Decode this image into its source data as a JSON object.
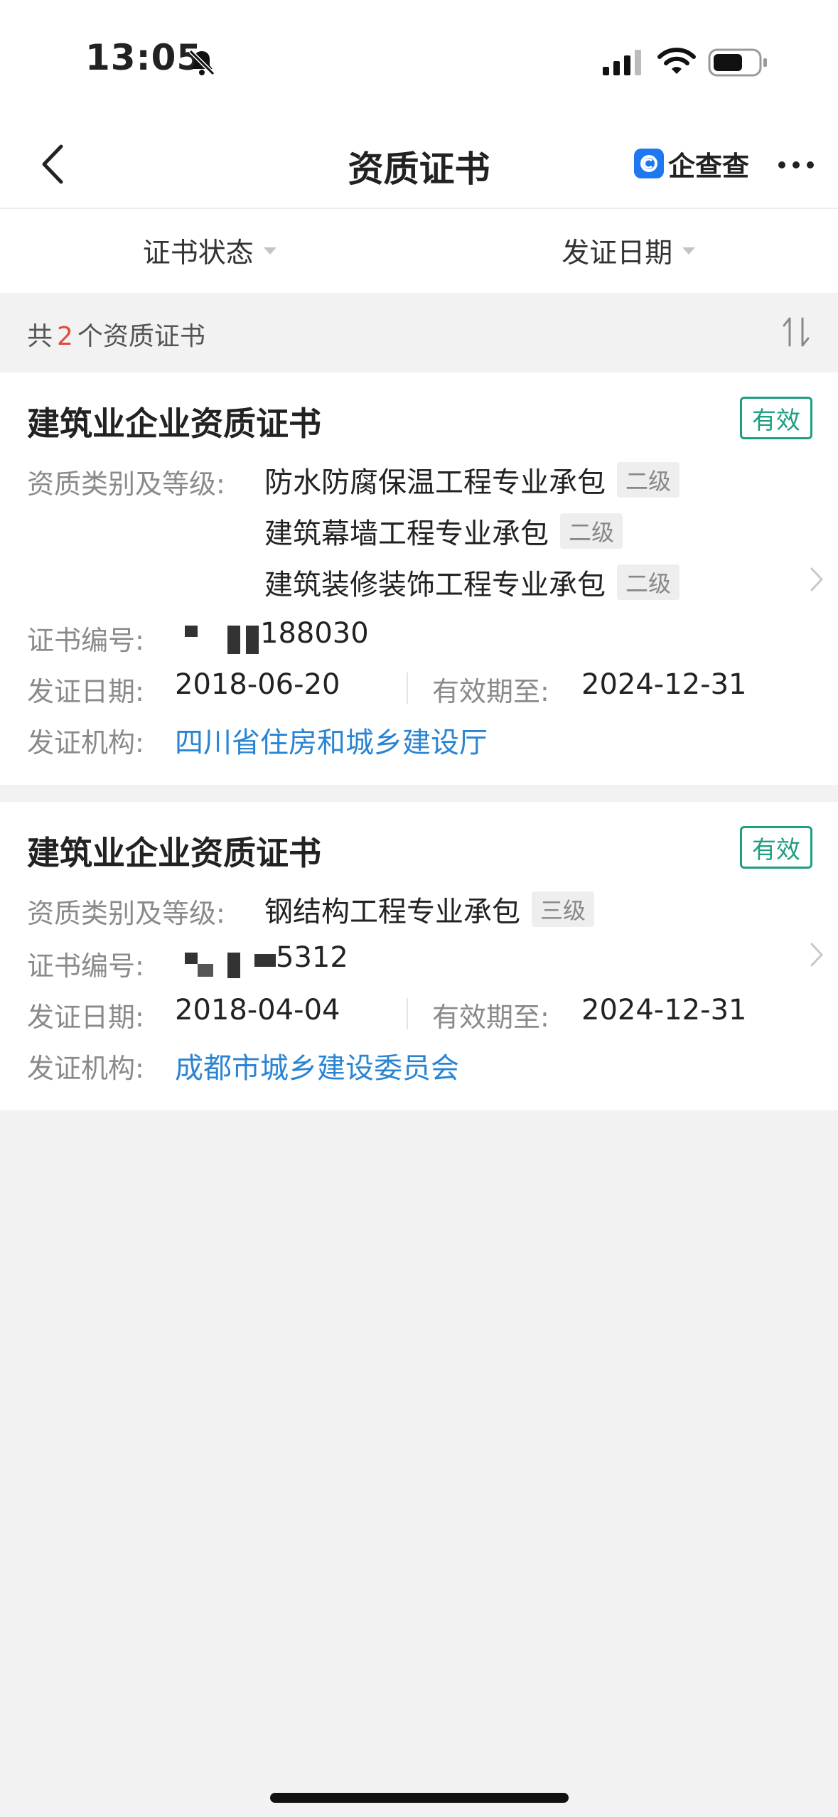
{
  "status_bar": {
    "time": "13:05"
  },
  "nav": {
    "title": "资质证书",
    "brand_name": "企查查"
  },
  "filters": [
    {
      "label": "证书状态"
    },
    {
      "label": "发证日期"
    }
  ],
  "summary": {
    "prefix": "共",
    "count": "2",
    "suffix": "个资质证书"
  },
  "labels": {
    "category": "资质类别及等级:",
    "cert_no": "证书编号:",
    "issue_date": "发证日期:",
    "valid_until": "有效期至:",
    "issuer": "发证机构:"
  },
  "certificates": [
    {
      "title": "建筑业企业资质证书",
      "status": "有效",
      "qualifications": [
        {
          "name": "防水防腐保温工程专业承包",
          "level": "二级"
        },
        {
          "name": "建筑幕墙工程专业承包",
          "level": "二级"
        },
        {
          "name": "建筑装修装饰工程专业承包",
          "level": "二级"
        }
      ],
      "cert_no_visible": "188030",
      "issue_date": "2018-06-20",
      "valid_until": "2024-12-31",
      "issuer": "四川省住房和城乡建设厅"
    },
    {
      "title": "建筑业企业资质证书",
      "status": "有效",
      "qualifications": [
        {
          "name": "钢结构工程专业承包",
          "level": "三级"
        }
      ],
      "cert_no_visible": "5312",
      "issue_date": "2018-04-04",
      "valid_until": "2024-12-31",
      "issuer": "成都市城乡建设委员会"
    }
  ],
  "colors": {
    "accent_red": "#e5483c",
    "valid_green": "#1f9e80",
    "link_blue": "#2b84d2",
    "brand_blue": "#1e78f0"
  }
}
